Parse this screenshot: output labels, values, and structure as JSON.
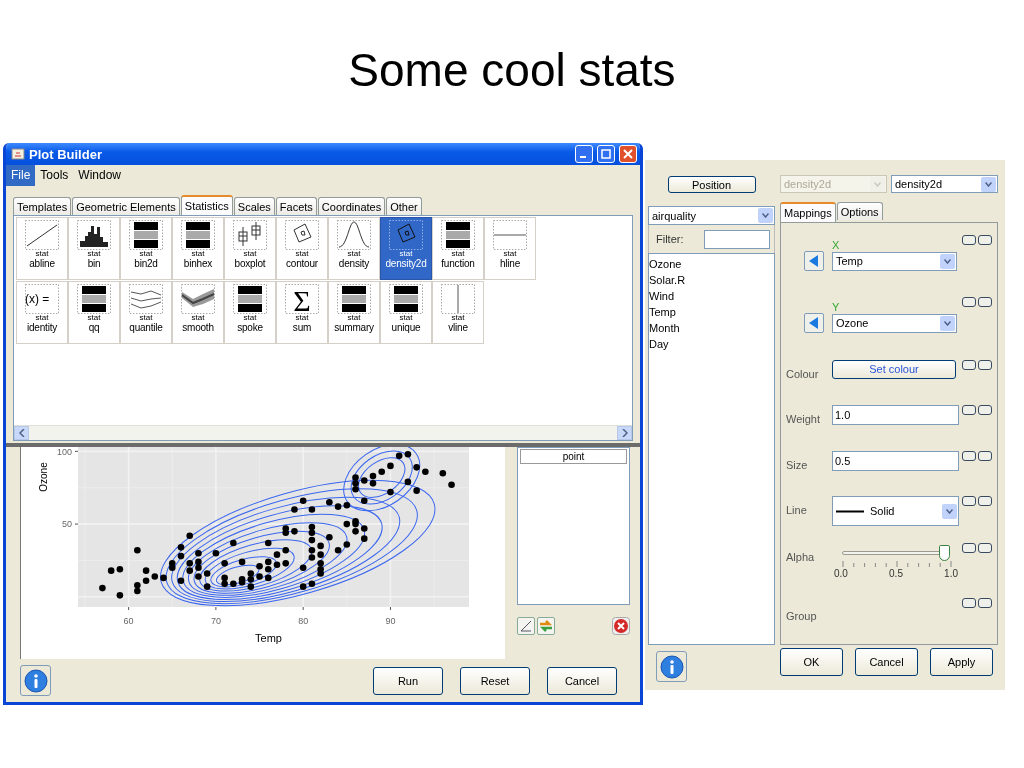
{
  "slide": {
    "title": "Some cool stats"
  },
  "plot_builder": {
    "window": {
      "title": "Plot Builder"
    },
    "menu": [
      {
        "label": "File",
        "selected": true
      },
      {
        "label": "Tools",
        "selected": false
      },
      {
        "label": "Window",
        "selected": false
      }
    ],
    "tabs": [
      {
        "label": "Templates",
        "selected": false
      },
      {
        "label": "Geometric Elements",
        "selected": false
      },
      {
        "label": "Statistics",
        "selected": true
      },
      {
        "label": "Scales",
        "selected": false
      },
      {
        "label": "Facets",
        "selected": false
      },
      {
        "label": "Coordinates",
        "selected": false
      },
      {
        "label": "Other",
        "selected": false
      }
    ],
    "stats": [
      {
        "label": "abline",
        "caption": "stat",
        "kind": "diagonal",
        "selected": false
      },
      {
        "label": "bin",
        "caption": "stat",
        "kind": "histogram",
        "selected": false
      },
      {
        "label": "bin2d",
        "caption": "stat",
        "kind": "bars",
        "selected": false
      },
      {
        "label": "binhex",
        "caption": "stat",
        "kind": "bars",
        "selected": false
      },
      {
        "label": "boxplot",
        "caption": "stat",
        "kind": "boxplot",
        "selected": false
      },
      {
        "label": "contour",
        "caption": "stat",
        "kind": "contour",
        "selected": false
      },
      {
        "label": "density",
        "caption": "stat",
        "kind": "bell",
        "selected": false
      },
      {
        "label": "density2d",
        "caption": "stat",
        "kind": "contour",
        "selected": true
      },
      {
        "label": "function",
        "caption": "stat",
        "kind": "bars",
        "selected": false
      },
      {
        "label": "hline",
        "caption": "stat",
        "kind": "hline",
        "selected": false
      },
      {
        "label": "identity",
        "caption": "stat",
        "kind": "formula",
        "icon_text": "(x) =",
        "selected": false
      },
      {
        "label": "qq",
        "caption": "stat",
        "kind": "bars",
        "selected": false
      },
      {
        "label": "quantile",
        "caption": "stat",
        "kind": "quantile",
        "selected": false
      },
      {
        "label": "smooth",
        "caption": "stat",
        "kind": "smooth",
        "selected": false
      },
      {
        "label": "spoke",
        "caption": "stat",
        "kind": "bars",
        "selected": false
      },
      {
        "label": "sum",
        "caption": "stat",
        "kind": "symbol",
        "icon_text": "Σ",
        "selected": false
      },
      {
        "label": "summary",
        "caption": "stat",
        "kind": "bars",
        "selected": false
      },
      {
        "label": "unique",
        "caption": "stat",
        "kind": "bars",
        "selected": false
      },
      {
        "label": "vline",
        "caption": "stat",
        "kind": "vline",
        "selected": false
      }
    ]
  },
  "layer_dialog": {
    "chart_data": {
      "type": "scatter",
      "xlabel": "Temp",
      "ylabel": "Ozone",
      "grid": true,
      "xlim": [
        54.2,
        99
      ],
      "ylim": [
        -7,
        103
      ],
      "xticks": [
        60,
        70,
        80,
        90
      ],
      "yticks": [
        50,
        100
      ],
      "x": [
        57,
        58,
        59,
        59,
        61,
        61,
        61,
        62,
        62,
        63,
        64,
        65,
        65,
        66,
        66,
        66,
        67,
        67,
        67,
        68,
        68,
        68,
        68,
        69,
        69,
        70,
        71,
        71,
        71,
        72,
        72,
        73,
        73,
        73,
        74,
        74,
        74,
        75,
        75,
        76,
        76,
        76,
        76,
        77,
        77,
        78,
        78,
        78,
        78,
        79,
        79,
        80,
        80,
        80,
        81,
        81,
        81,
        81,
        81,
        81,
        81,
        82,
        82,
        82,
        82,
        82,
        83,
        83,
        84,
        84,
        85,
        85,
        85,
        86,
        86,
        86,
        86,
        86,
        86,
        87,
        87,
        87,
        87,
        88,
        88,
        89,
        90,
        90,
        91,
        92,
        92,
        93,
        93,
        94,
        96,
        97
      ],
      "values": [
        6,
        18,
        19,
        1,
        32,
        8,
        4,
        18,
        11,
        14,
        13,
        23,
        20,
        34,
        28,
        11,
        42,
        23,
        18,
        30,
        24,
        20,
        14,
        16,
        7,
        30,
        23,
        13,
        9,
        37,
        9,
        24,
        12,
        10,
        16,
        12,
        7,
        21,
        14,
        37,
        24,
        19,
        13,
        29,
        22,
        47,
        44,
        32,
        23,
        60,
        45,
        66,
        20,
        7,
        60,
        48,
        44,
        39,
        32,
        27,
        9,
        35,
        29,
        23,
        19,
        16,
        65,
        41,
        62,
        32,
        63,
        50,
        36,
        82,
        78,
        74,
        52,
        50,
        45,
        80,
        66,
        47,
        40,
        83,
        78,
        86,
        90,
        72,
        97,
        98,
        79,
        89,
        73,
        86,
        85,
        77
      ]
    },
    "layers": [
      {
        "label": "point"
      }
    ],
    "buttons": [
      "Run",
      "Reset",
      "Cancel"
    ]
  },
  "aesthetics": {
    "position_button": "Position",
    "geom_combos": [
      {
        "value": "density2d",
        "disabled": true
      },
      {
        "value": "density2d",
        "disabled": false
      }
    ],
    "dataset": {
      "value": "airquality"
    },
    "filter": {
      "label": "Filter:"
    },
    "variables": [
      "Ozone",
      "Solar.R",
      "Wind",
      "Temp",
      "Month",
      "Day"
    ],
    "tabs": [
      {
        "label": "Mappings",
        "selected": true
      },
      {
        "label": "Options",
        "selected": false
      }
    ],
    "mappings": [
      {
        "kind": "variable",
        "axis": "X",
        "value": "Temp"
      },
      {
        "kind": "variable",
        "axis": "Y",
        "value": "Ozone"
      },
      {
        "kind": "button",
        "label": "Colour",
        "value": "Set colour"
      },
      {
        "kind": "text",
        "label": "Weight",
        "value": "1.0"
      },
      {
        "kind": "text",
        "label": "Size",
        "value": "0.5"
      },
      {
        "kind": "line",
        "label": "Line",
        "value": "Solid"
      },
      {
        "kind": "slider",
        "label": "Alpha",
        "level": 1,
        "ticks": [
          "0.0",
          "0.5",
          "1.0"
        ]
      },
      {
        "kind": "empty",
        "label": "Group"
      }
    ],
    "buttons": [
      "OK",
      "Cancel",
      "Apply"
    ]
  }
}
